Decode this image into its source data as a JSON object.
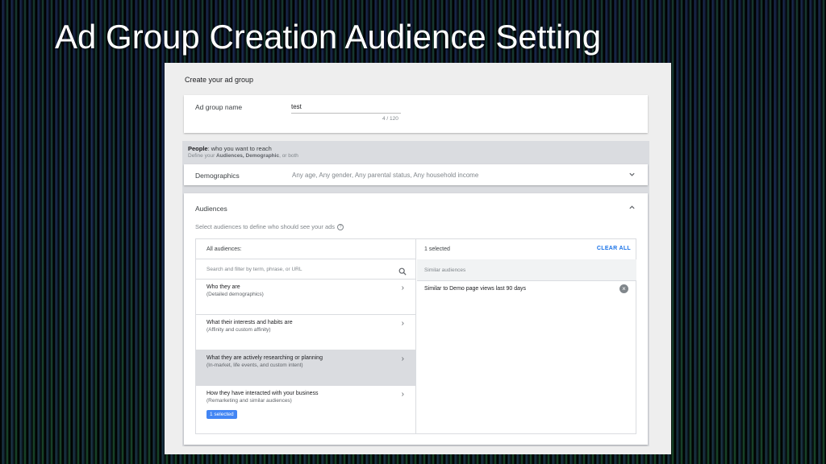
{
  "slide": {
    "title": "Ad Group Creation Audience Setting"
  },
  "page": {
    "header": "Create your ad group"
  },
  "ad_group_name": {
    "label": "Ad group name",
    "value": "test",
    "counter": "4 / 120"
  },
  "people": {
    "title_bold": "People",
    "title_rest": ": who you want to reach",
    "subtitle_pre": "Define your ",
    "subtitle_bold": "Audiences, Demographic",
    "subtitle_post": ", or both"
  },
  "demographics": {
    "label": "Demographics",
    "summary": "Any age, Any gender, Any parental status, Any household income",
    "chevron": "chevron-down-icon"
  },
  "audiences": {
    "label": "Audiences",
    "chevron": "chevron-up-icon",
    "instruction": "Select audiences to define who should see your ads",
    "help_icon": "?",
    "left": {
      "header": "All audiences:",
      "search_placeholder": "Search and filter by term, phrase, or URL",
      "categories": [
        {
          "title": "Who they are",
          "subtitle": "(Detailed demographics)",
          "arrow": "›"
        },
        {
          "title": "What their interests and habits are",
          "subtitle": "(Affinity and custom affinity)",
          "arrow": "›"
        },
        {
          "title": "What they are actively researching or planning",
          "subtitle": "(In-market, life events, and custom intent)",
          "arrow": "›"
        },
        {
          "title": "How they have interacted with your business",
          "subtitle": "(Remarketing and similar audiences)",
          "arrow": "›",
          "badge": "1 selected"
        }
      ]
    },
    "right": {
      "selected_count": "1 selected",
      "clear_all": "CLEAR ALL",
      "group_header": "Similar audiences",
      "items": [
        {
          "label": "Similar to Demo page views last 90 days",
          "remove": "×"
        }
      ]
    }
  },
  "colors": {
    "accent": "#1a73e8",
    "badge": "#4285f4",
    "active_row": "#dadce0"
  }
}
